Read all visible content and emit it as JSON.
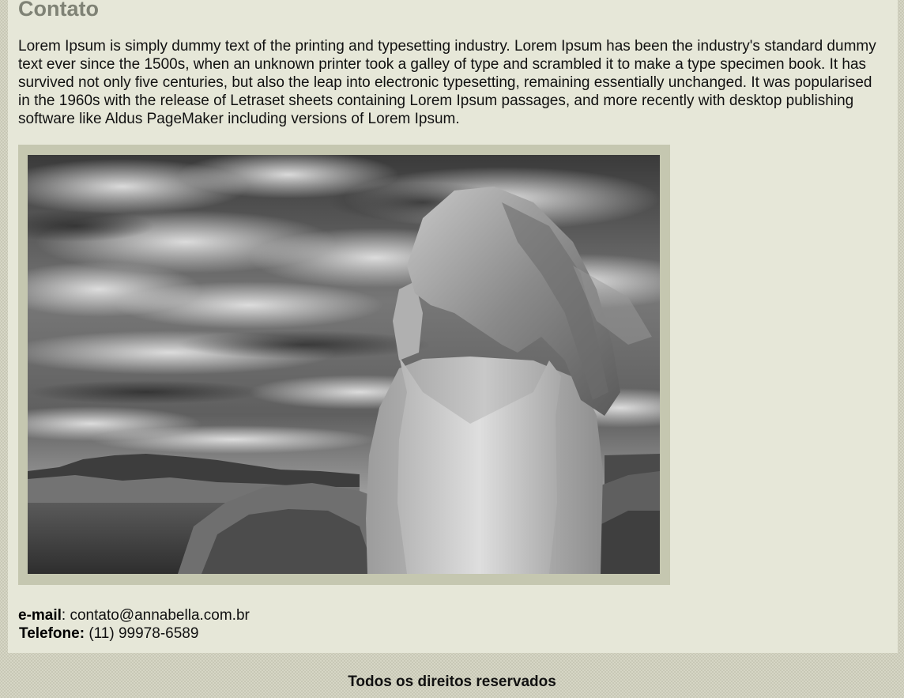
{
  "page": {
    "title": "Contato",
    "intro": "Lorem Ipsum is simply dummy text of the printing and typesetting industry. Lorem Ipsum has been the industry's standard dummy text ever since the 1500s, when an unknown printer took a galley of type and scrambled it to make a type specimen book. It has survived not only five centuries, but also the leap into electronic typesetting, remaining essentially unchanged. It was popularised in the 1960s with the release of Letraset sheets containing Lorem Ipsum passages, and more recently with desktop publishing software like Aldus PageMaker including versions of Lorem Ipsum."
  },
  "contact": {
    "email_label": "e-mail",
    "email_value": "contato@annabella.com.br",
    "phone_label": "Telefone:",
    "phone_value": "(11) 99978-6589"
  },
  "footer": {
    "text": "Todos os direitos reservados"
  },
  "colors": {
    "background": "#d6d6c5",
    "panel": "#e6e7d8",
    "title": "#7f8275",
    "frame": "#c5c7b0"
  }
}
